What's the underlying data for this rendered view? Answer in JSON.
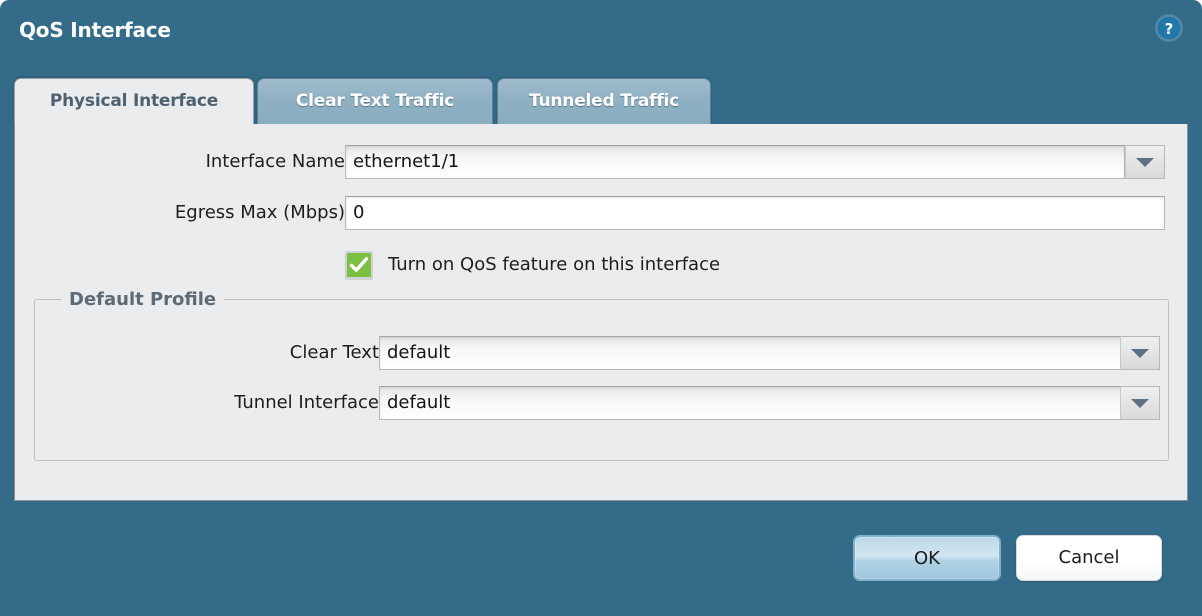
{
  "window": {
    "title": "QoS Interface",
    "help_icon": "help-circle-icon",
    "frame_color": "#336b89",
    "panel_color": "#ebecee"
  },
  "tabs": [
    {
      "label": "Physical Interface",
      "active": true
    },
    {
      "label": "Clear Text Traffic",
      "active": false
    },
    {
      "label": "Tunneled Traffic",
      "active": false
    }
  ],
  "form": {
    "interface_name": {
      "label": "Interface Name",
      "value": "ethernet1/1",
      "type": "combobox",
      "dropdown_icon": "chevron-down-icon"
    },
    "egress_max": {
      "label": "Egress Max (Mbps)",
      "value": "0",
      "type": "text"
    },
    "qos_toggle": {
      "label": "Turn on QoS feature on this interface",
      "checked": true,
      "check_color": "#7cc043"
    }
  },
  "default_profile": {
    "legend": "Default Profile",
    "clear_text": {
      "label": "Clear Text",
      "value": "default",
      "type": "combobox",
      "dropdown_icon": "chevron-down-icon"
    },
    "tunnel_interface": {
      "label": "Tunnel Interface",
      "value": "default",
      "type": "combobox",
      "dropdown_icon": "chevron-down-icon"
    }
  },
  "footer": {
    "ok_label": "OK",
    "cancel_label": "Cancel"
  }
}
